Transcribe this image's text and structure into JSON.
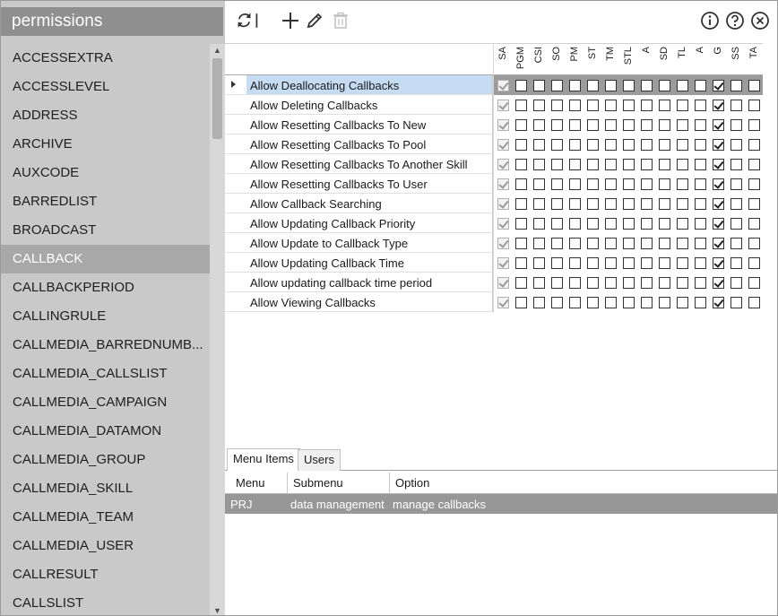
{
  "panel": {
    "title": "permissions",
    "items": [
      {
        "label": "ACCESSEXTRA"
      },
      {
        "label": "ACCESSLEVEL"
      },
      {
        "label": "ADDRESS"
      },
      {
        "label": "ARCHIVE"
      },
      {
        "label": "AUXCODE"
      },
      {
        "label": "BARREDLIST"
      },
      {
        "label": "BROADCAST"
      },
      {
        "label": "CALLBACK",
        "selected": true
      },
      {
        "label": "CALLBACKPERIOD"
      },
      {
        "label": "CALLINGRULE"
      },
      {
        "label": "CALLMEDIA_BARREDNUMB..."
      },
      {
        "label": "CALLMEDIA_CALLSLIST"
      },
      {
        "label": "CALLMEDIA_CAMPAIGN"
      },
      {
        "label": "CALLMEDIA_DATAMON"
      },
      {
        "label": "CALLMEDIA_GROUP"
      },
      {
        "label": "CALLMEDIA_SKILL"
      },
      {
        "label": "CALLMEDIA_TEAM"
      },
      {
        "label": "CALLMEDIA_USER"
      },
      {
        "label": "CALLRESULT"
      },
      {
        "label": "CALLSLIST"
      }
    ]
  },
  "toolbar": {
    "refresh_icon": "refresh-icon",
    "add_icon": "plus-icon",
    "edit_icon": "pencil-icon",
    "delete_icon": "trash-icon",
    "info_icon": "info-icon",
    "help_icon": "help-icon",
    "close_icon": "close-icon"
  },
  "grid": {
    "columns": [
      "SA",
      "PGM",
      "CSI",
      "SO",
      "PM",
      "ST",
      "TM",
      "STL",
      "A",
      "SD",
      "TL",
      "A",
      "G",
      "SS",
      "TA"
    ],
    "rows": [
      {
        "label": "Allow Deallocating Callbacks",
        "selected": true,
        "checked": [
          0,
          12
        ]
      },
      {
        "label": "Allow Deleting Callbacks",
        "checked": [
          0,
          12
        ]
      },
      {
        "label": "Allow Resetting Callbacks To New",
        "checked": [
          0,
          12
        ]
      },
      {
        "label": "Allow Resetting Callbacks To Pool",
        "checked": [
          0,
          12
        ]
      },
      {
        "label": "Allow Resetting Callbacks To Another Skill",
        "checked": [
          0,
          12
        ]
      },
      {
        "label": "Allow Resetting Callbacks To User",
        "checked": [
          0,
          12
        ]
      },
      {
        "label": "Allow Callback Searching",
        "checked": [
          0,
          12
        ]
      },
      {
        "label": "Allow Updating Callback Priority",
        "checked": [
          0,
          12
        ]
      },
      {
        "label": "Allow Update to Callback Type",
        "checked": [
          0,
          12
        ]
      },
      {
        "label": "Allow Updating Callback Time",
        "checked": [
          0,
          12
        ]
      },
      {
        "label": "Allow updating callback time period",
        "checked": [
          0,
          12
        ]
      },
      {
        "label": "Allow Viewing Callbacks",
        "checked": [
          0,
          12
        ]
      }
    ]
  },
  "bottom": {
    "tabs": [
      {
        "label": "Menu Items",
        "active": true
      },
      {
        "label": "Users"
      }
    ],
    "columns": [
      "Menu",
      "Submenu",
      "Option"
    ],
    "rows": [
      {
        "cells": [
          "PRJ",
          "data management",
          "manage callbacks"
        ]
      }
    ]
  }
}
